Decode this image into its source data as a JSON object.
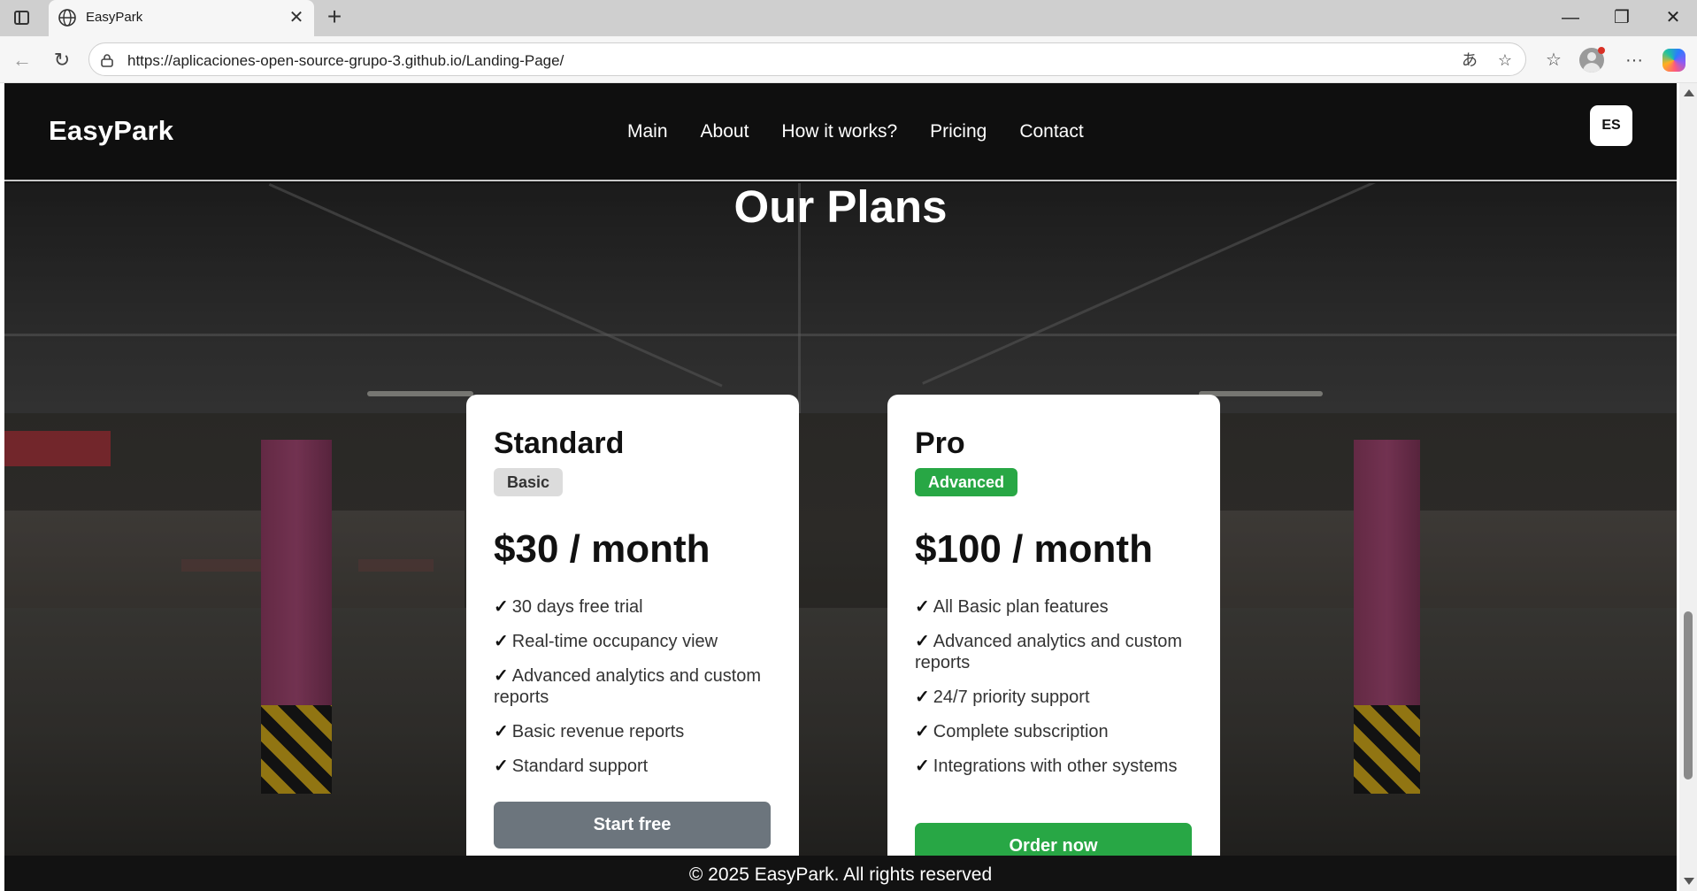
{
  "browser": {
    "tab_title": "EasyPark",
    "url": "https://aplicaciones-open-source-grupo-3.github.io/Landing-Page/",
    "icons": {
      "sidebar": "sidebar-toggle-icon",
      "globe": "globe-icon",
      "close_tab": "close-icon",
      "new_tab": "plus-icon",
      "back": "back-arrow-icon",
      "reload": "reload-icon",
      "site_info": "lock-icon",
      "read_aloud": "translate-icon",
      "favorite": "star-icon",
      "favorites_list": "favorites-icon",
      "profile": "profile-icon",
      "more": "more-icon",
      "copilot": "copilot-icon"
    },
    "glyphs": {
      "close_tab": "✕",
      "new_tab": "+",
      "minimize": "—",
      "restore": "❐",
      "close_window": "✕",
      "back": "←",
      "reload": "↻",
      "translate": "あ",
      "star": "☆",
      "favorites": "☆",
      "more": "···"
    }
  },
  "site": {
    "brand": "EasyPark",
    "nav": [
      "Main",
      "About",
      "How it works?",
      "Pricing",
      "Contact"
    ],
    "language_button": "ES"
  },
  "plans_section": {
    "title": "Our Plans",
    "plans": [
      {
        "name": "Standard",
        "badge": "Basic",
        "price": "$30 / month",
        "features": [
          "30 days free trial",
          "Real-time occupancy view",
          "Advanced analytics and custom reports",
          "Basic revenue reports",
          "Standard support"
        ],
        "cta": "Start free"
      },
      {
        "name": "Pro",
        "badge": "Advanced",
        "price": "$100 / month",
        "features": [
          "All Basic plan features",
          "Advanced analytics and custom reports",
          "24/7 priority support",
          "Complete subscription",
          "Integrations with other systems"
        ],
        "cta": "Order now"
      }
    ],
    "check_glyph": "✓"
  },
  "footer": {
    "copyright": "© 2025 EasyPark. All rights reserved"
  },
  "colors": {
    "header_bg": "#0f0f0f",
    "card_bg": "#ffffff",
    "green": "#28a745",
    "gray_button": "#6c757d",
    "basic_badge": "#dcdcdc"
  }
}
